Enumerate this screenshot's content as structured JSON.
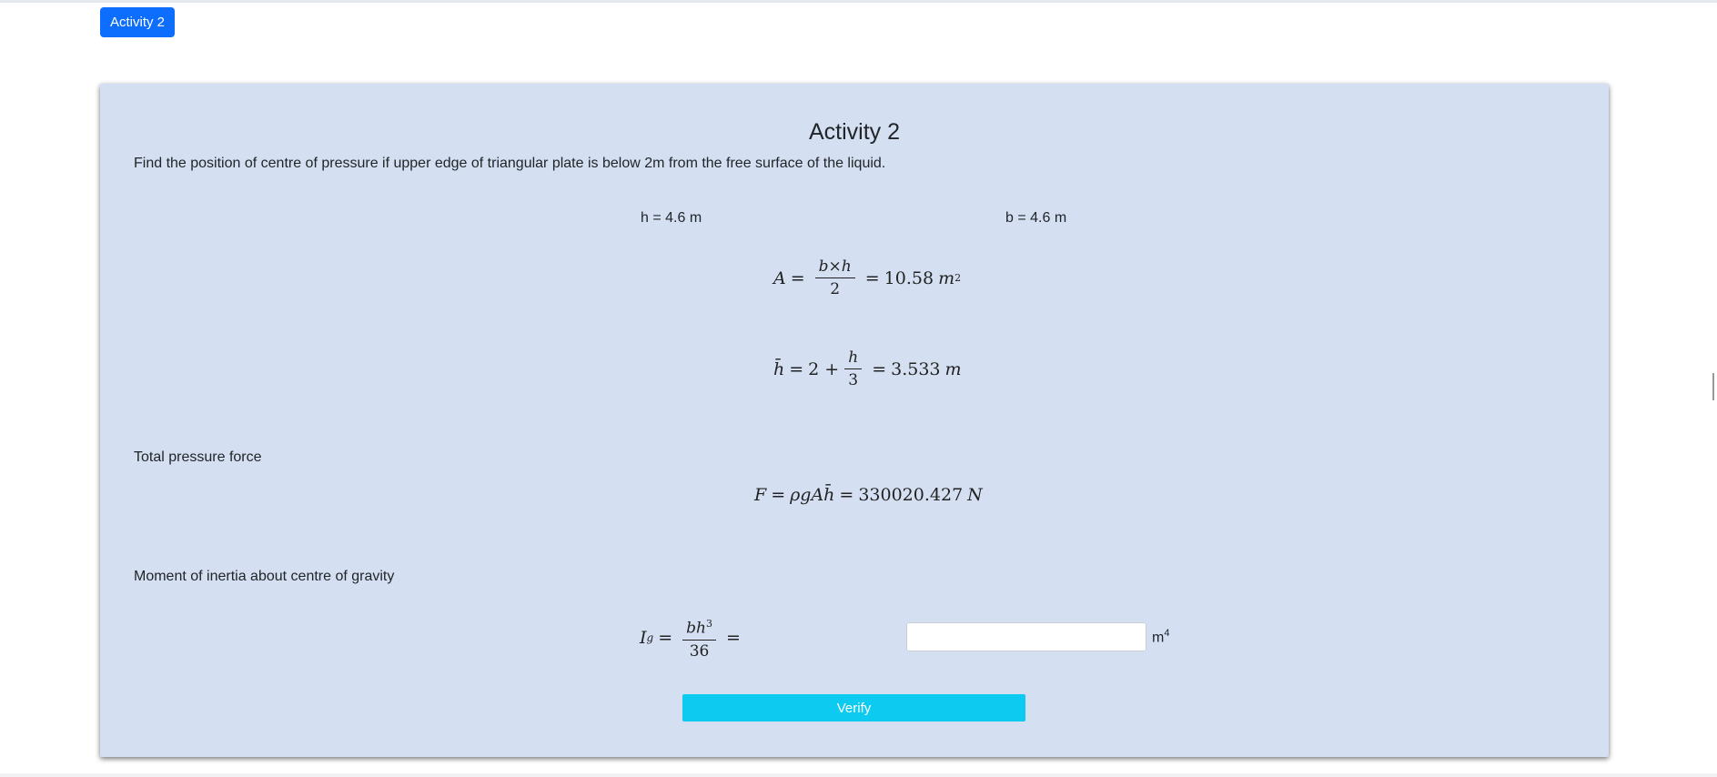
{
  "header": {
    "tab_label": "Activity 2"
  },
  "activity": {
    "title": "Activity 2",
    "problem": "Find the position of centre of pressure if upper edge of triangular plate is below 2m from the free surface of the liquid.",
    "given_h": "h = 4.6 m",
    "given_b": "b = 4.6 m",
    "area_eq": {
      "lhs": "A",
      "numerator": "b×h",
      "denominator": "2",
      "result": "10.58",
      "unit": "m",
      "unit_exp": "2"
    },
    "hbar_eq": {
      "lhs": "h̄",
      "prefix": "2 +",
      "numerator": "h",
      "denominator": "3",
      "result": "3.533",
      "unit": "m"
    },
    "force_section_label": "Total pressure force",
    "force_eq": {
      "lhs": "F",
      "expr": "ρgAh̄",
      "result": "330020.427",
      "unit": "N"
    },
    "inertia_section_label": "Moment of inertia about centre of gravity",
    "inertia_eq": {
      "lhs": "I",
      "lhs_sub": "g",
      "numerator": "bh",
      "numerator_exp": "3",
      "denominator": "36"
    },
    "answer": {
      "value": "",
      "unit": "m",
      "unit_exp": "4"
    },
    "verify_label": "Verify"
  },
  "colors": {
    "primary": "#0d6efd",
    "card_bg": "#d4e0f2",
    "verify": "#0dcaf0"
  }
}
